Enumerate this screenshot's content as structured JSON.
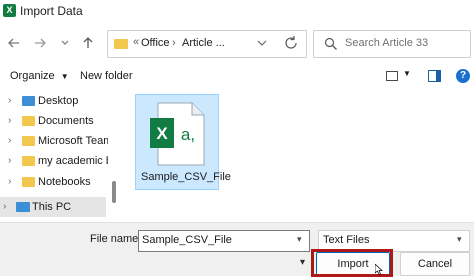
{
  "window": {
    "title": "Import Data",
    "app_icon_letter": "X"
  },
  "nav": {
    "back_icon": "back-arrow-icon",
    "forward_icon": "forward-arrow-icon",
    "recent_icon": "chevron-down-icon",
    "up_icon": "up-arrow-icon",
    "refresh_icon": "refresh-icon"
  },
  "address": {
    "overflow": "«",
    "segments": [
      "Office",
      "Article ..."
    ],
    "separator": "›"
  },
  "search": {
    "placeholder": "Search Article 33"
  },
  "toolbar": {
    "organize": "Organize",
    "new_folder": "New folder"
  },
  "sidebar": {
    "items": [
      {
        "label": "Desktop",
        "icon": "desktop-folder-icon",
        "color": "#3a8fd6"
      },
      {
        "label": "Documents",
        "icon": "folder-icon",
        "color": "#f3c74d"
      },
      {
        "label": "Microsoft Teams",
        "icon": "folder-icon",
        "color": "#f3c74d"
      },
      {
        "label": "my academic ba",
        "icon": "folder-icon",
        "color": "#f3c74d"
      },
      {
        "label": "Notebooks",
        "icon": "folder-icon",
        "color": "#f3c74d"
      },
      {
        "label": "This PC",
        "icon": "computer-icon",
        "color": "#3a8fd6"
      }
    ]
  },
  "files": [
    {
      "name": "Sample_CSV_File",
      "icon": "excel-csv-icon",
      "icon_text": "X a,",
      "selected": true
    }
  ],
  "footer": {
    "file_name_label": "File name:",
    "file_name_value": "Sample_CSV_File",
    "file_type_value": "Text Files",
    "tools_label": "▾",
    "import_label": "Import",
    "cancel_label": "Cancel"
  },
  "colors": {
    "accent": "#107c41",
    "selection": "#cce8ff",
    "highlight_box": "#b01818"
  }
}
